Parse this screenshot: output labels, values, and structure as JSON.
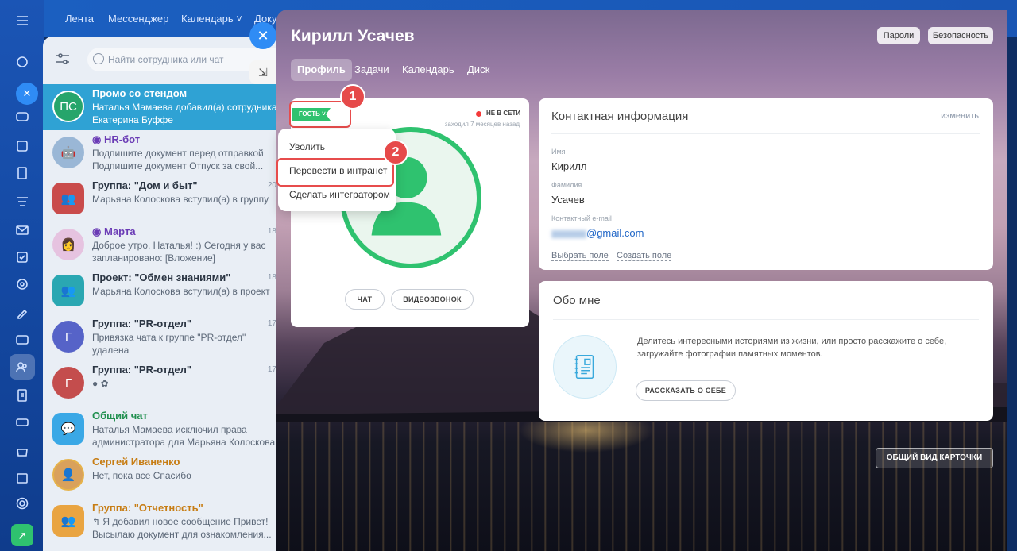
{
  "topnav": {
    "items": [
      "Лента",
      "Мессенджер",
      "Календарь",
      "Доку"
    ]
  },
  "chats": {
    "search_placeholder": "Найти сотрудника или чат",
    "rows": [
      {
        "name": "Промо со стендом",
        "line1": "Наталья Мамаева добавил(а) сотрудника",
        "line2": "Екатерина Буффе",
        "avatar": "ПС",
        "time": "",
        "color": "#26a56b"
      },
      {
        "name": "HR-бот",
        "line1": "Подпишите документ перед отправкой",
        "line2": "Подпишите документ Отпуск за свой...",
        "avatar": "",
        "time": "",
        "color": "#9ab7d6"
      },
      {
        "name": "Группа: \"Дом и быт\"",
        "line1": "Марьяна Колоскова вступил(а) в группу",
        "line2": "",
        "avatar": "",
        "time": "20",
        "color": "#c94b4b"
      },
      {
        "name": "Марта",
        "line1": "Доброе утро, Наталья! :) Сегодня у вас",
        "line2": "запланировано: [Вложение]",
        "avatar": "",
        "time": "18",
        "color": "#e6c3e0"
      },
      {
        "name": "Проект: \"Обмен знаниями\"",
        "line1": "Марьяна Колоскова вступил(а) в проект",
        "line2": "",
        "avatar": "",
        "time": "18",
        "color": "#2aa7b2"
      },
      {
        "name": "Группа: \"PR-отдел\"",
        "line1": "Привязка чата к группе \"PR-отдел\"",
        "line2": "удалена",
        "avatar": "Г",
        "time": "17",
        "color": "#5663c8"
      },
      {
        "name": "Группа: \"PR-отдел\"",
        "line1": "",
        "line2": "",
        "avatar": "Г",
        "time": "17",
        "color": "#c44d4d"
      },
      {
        "name": "Общий чат",
        "line1": "Наталья Мамаева исключил права",
        "line2": "администратора для Марьяна Колоскова.",
        "avatar": "",
        "time": "",
        "color": "#3aa8e6"
      },
      {
        "name": "Сергей Иваненко",
        "line1": "Нет, пока все Спасибо",
        "line2": "",
        "avatar": "",
        "time": "",
        "color": "#d9a15c"
      },
      {
        "name": "Группа: \"Отчетность\"",
        "line1": "↰ Я добавил новое сообщение Привет!",
        "line2": "Высылаю документ для ознакомления...",
        "avatar": "",
        "time": "",
        "color": "#e9a441"
      }
    ]
  },
  "profile": {
    "title": "Кирилл Усачев",
    "buttons": {
      "passwords": "Пароли",
      "security": "Безопасность"
    },
    "tabs": [
      "Профиль",
      "Задачи",
      "Календарь",
      "Диск"
    ],
    "guest_tag": "ГОСТЬ",
    "status": "НЕ В СЕТИ",
    "last_seen": "заходил 7 месяцев назад",
    "menu": [
      "Уволить",
      "Перевести в интранет",
      "Сделать интегратором"
    ],
    "badges": [
      "1",
      "2"
    ],
    "actions": {
      "chat": "ЧАТ",
      "video": "ВИДЕОЗВОНОК"
    }
  },
  "contact": {
    "heading": "Контактная информация",
    "edit": "изменить",
    "name_label": "Имя",
    "name": "Кирилл",
    "surname_label": "Фамилия",
    "surname": "Усачев",
    "email_label": "Контактный e-mail",
    "email_visible": "@gmail.com",
    "choose_field": "Выбрать поле",
    "create_field": "Создать поле"
  },
  "about": {
    "heading": "Обо мне",
    "text1": "Делитесь интересными историями из жизни, или просто расскажите о себе,",
    "text2": "загружайте фотографии памятных моментов.",
    "button": "РАССКАЗАТЬ О СЕБЕ"
  },
  "summary_button": "ОБЩИЙ ВИД КАРТОЧКИ",
  "colors": {
    "accent": "#2fc26f",
    "highlight": "#e74c4c",
    "blue": "#2f8cf5"
  }
}
